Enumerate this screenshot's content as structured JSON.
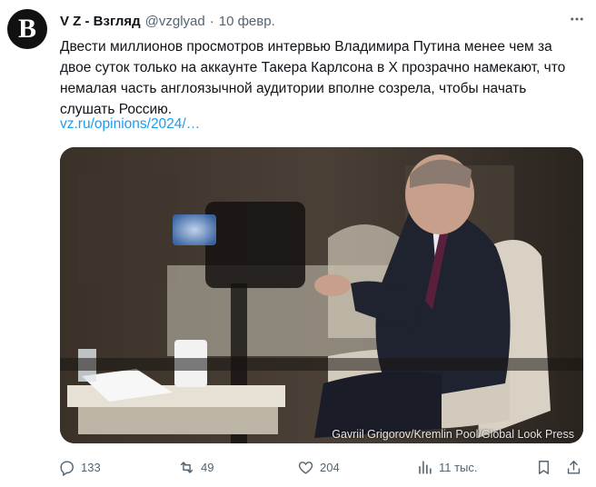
{
  "author": {
    "avatar_letter": "B",
    "name": "V Z - Взгляд",
    "handle": "@vzglyad",
    "separator": "·",
    "date": "10 февр."
  },
  "tweet": {
    "text": "Двести миллионов просмотров интервью Владимира Путина менее чем за двое суток только на аккаунте Такера Карлсона в Х прозрачно намекают, что немалая часть англоязычной аудитории вполне созрела, чтобы начать слушать Россию.",
    "link": "vz.ru/opinions/2024/…"
  },
  "media": {
    "caption": "Gavriil Grigorov/Kremlin Pool/Global Look Press"
  },
  "actions": {
    "replies": "133",
    "retweets": "49",
    "likes": "204",
    "views": "11 тыс."
  },
  "icons": {
    "more": "more-horizontal-icon",
    "reply": "reply-icon",
    "retweet": "retweet-icon",
    "like": "heart-icon",
    "views": "views-bar-chart-icon",
    "bookmark": "bookmark-icon",
    "share": "share-icon"
  },
  "colors": {
    "link": "#1d9bf0",
    "muted": "#536471",
    "text": "#0f1419"
  }
}
